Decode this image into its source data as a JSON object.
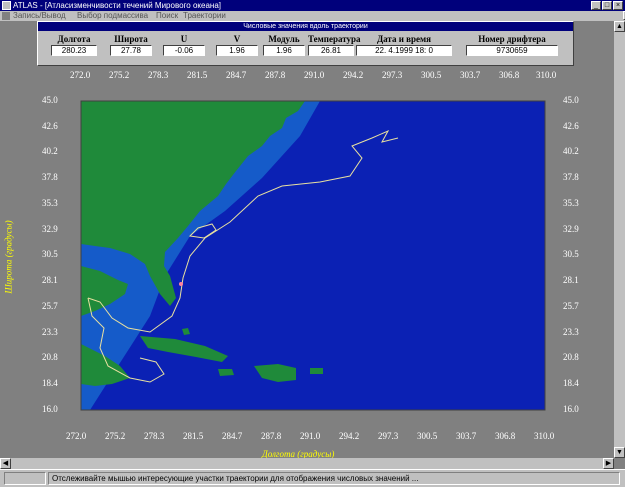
{
  "window": {
    "title": "ATLAS - [Атласизменчивости течений Мирового океана]",
    "min_glyph": "_",
    "max_glyph": "□",
    "close_glyph": "×"
  },
  "menu": {
    "items": [
      "Запись/Вывод",
      "Выбор подмассива",
      "Поиск",
      "Траектории"
    ]
  },
  "info_panel": {
    "title": "Числовые значения вдоль траектории",
    "columns": [
      {
        "label": "Долгота",
        "value": "280.23"
      },
      {
        "label": "Широта",
        "value": "27.78"
      },
      {
        "label": "U",
        "value": "-0.06"
      },
      {
        "label": "V",
        "value": "1.96"
      },
      {
        "label": "Модуль",
        "value": "1.96"
      },
      {
        "label": "Температура",
        "value": "26.81"
      },
      {
        "label": "Дата и время",
        "value": "22. 4.1999  18: 0"
      },
      {
        "label": "Номер дрифтера",
        "value": "9730659"
      }
    ]
  },
  "map": {
    "x_ticks": [
      "272.0",
      "275.2",
      "278.3",
      "281.5",
      "284.7",
      "287.8",
      "291.0",
      "294.2",
      "297.3",
      "300.5",
      "303.7",
      "306.8",
      "310.0"
    ],
    "y_ticks": [
      "45.0",
      "42.6",
      "40.2",
      "37.8",
      "35.3",
      "32.9",
      "30.5",
      "28.1",
      "25.7",
      "23.3",
      "20.8",
      "18.4",
      "16.0"
    ],
    "xlabel": "Долгота (градусы)",
    "ylabel": "Широта (градусы)",
    "colors": {
      "ocean_deep": "#0b21b4",
      "ocean_shelf": "#1a6fd0",
      "land": "#1f8a3a",
      "track": "#e8e0a0",
      "axis_title": "#ffff00"
    }
  },
  "status": {
    "message": "Отслеживайте мышью интересующие участки траектории для отображения числовых значений ..."
  }
}
